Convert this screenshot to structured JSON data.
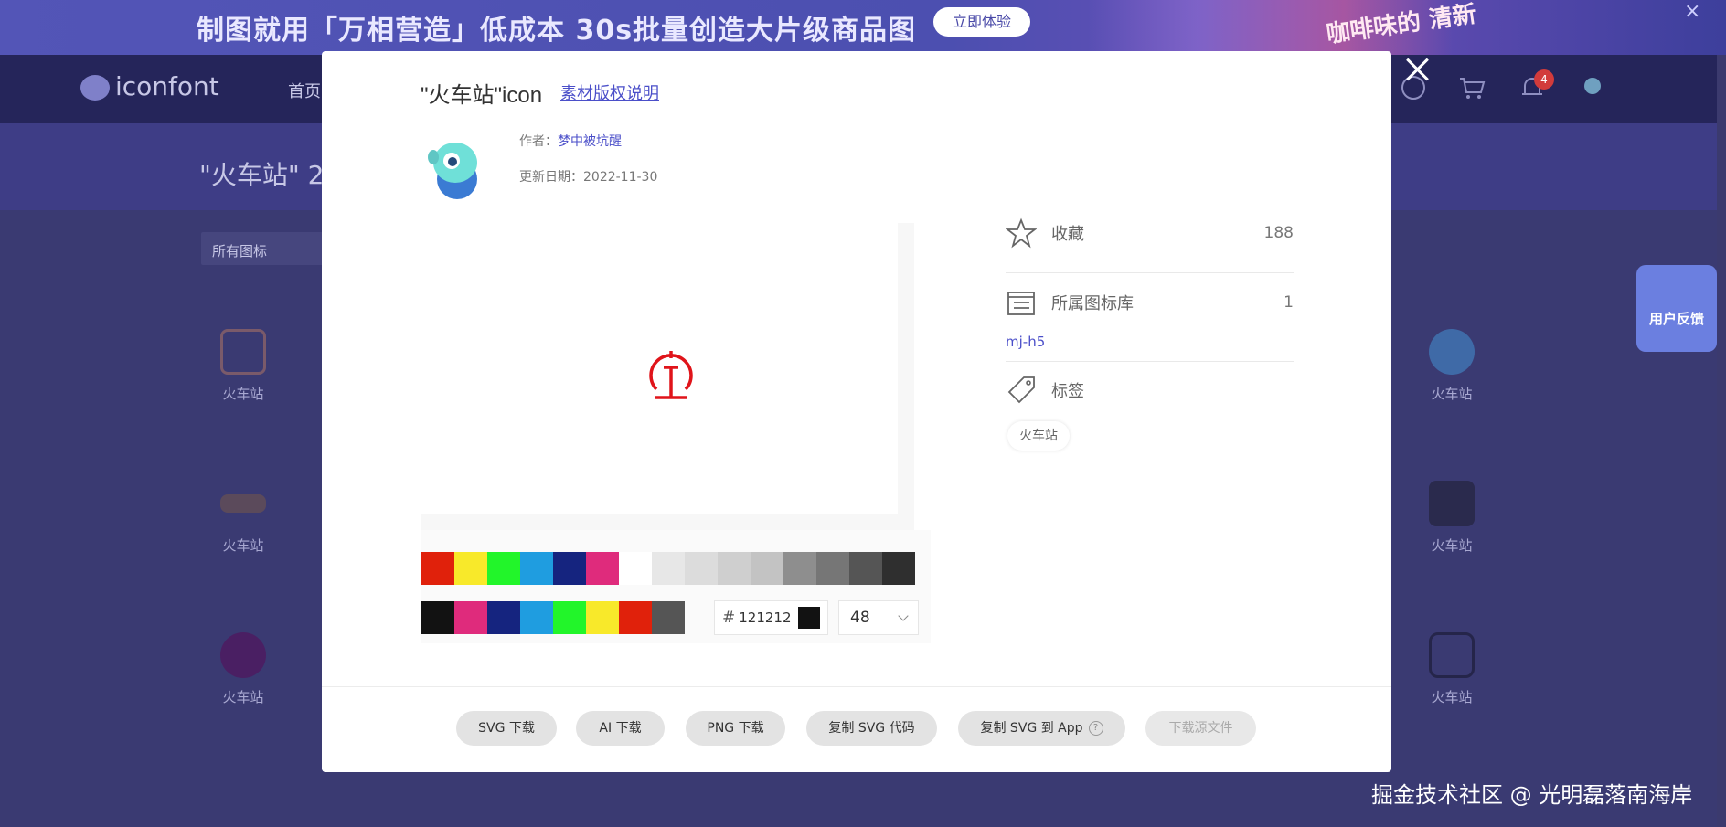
{
  "background": {
    "banner_text": "制图就用「万相营造」低成本 30s批量创造大片级商品图",
    "banner_button": "立即体验",
    "banner_close": "×",
    "promo_text": "咖啡味的 清新",
    "logo_text": "iconfont",
    "nav_home": "首页",
    "notification_count": "4",
    "page_title": "\"火车站\" 2",
    "filter_label": "所有图标",
    "icon_label": "火车站",
    "feedback_label": "用户反馈",
    "watermark": "掘金技术社区 @ 光明磊落南海岸"
  },
  "modal": {
    "title": "\"火车站\"icon",
    "copyright_link": "素材版权说明",
    "author_label": "作者：",
    "author_name": "梦中被坑醒",
    "date_label": "更新日期：",
    "date_value": "2022-11-30",
    "colors": {
      "preview_icon": "#e0141a",
      "palette_row1": [
        "#e0210b",
        "#f8e92a",
        "#22f52a",
        "#1f9de0",
        "#15247f",
        "#df2b7c",
        "#ffffff",
        "#e7e7e7",
        "#dcdcdc",
        "#cfcfcf",
        "#c3c3c3",
        "#8e8e8e",
        "#767676",
        "#555555",
        "#2f2f2f"
      ],
      "palette_row2": [
        "#121212",
        "#df2b7c",
        "#15247f",
        "#1f9de0",
        "#22f52a",
        "#f8e92a",
        "#e0210b",
        "#555555"
      ]
    },
    "hex_value": "121212",
    "hex_hash": "#",
    "size_value": "48",
    "favorites_label": "收藏",
    "favorites_count": "188",
    "library_label": "所属图标库",
    "library_count": "1",
    "library_name": "mj-h5",
    "tags_label": "标签",
    "tag": "火车站",
    "buttons": {
      "svg_download": "SVG 下载",
      "ai_download": "AI 下载",
      "png_download": "PNG 下载",
      "copy_svg_code": "复制 SVG 代码",
      "copy_svg_app": "复制 SVG 到 App",
      "download_source": "下载源文件"
    }
  }
}
